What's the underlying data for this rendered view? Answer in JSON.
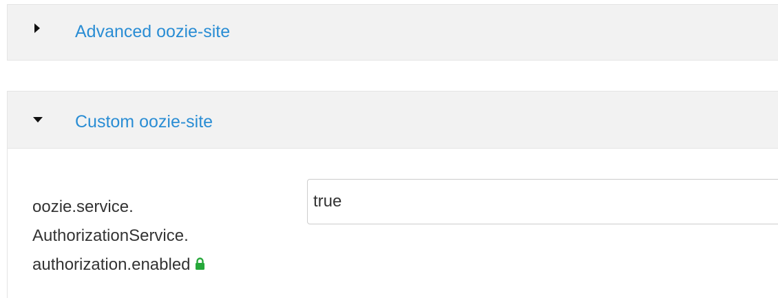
{
  "sections": {
    "advanced": {
      "title": "Advanced oozie-site",
      "expanded": false,
      "icon": "caret-right-icon"
    },
    "custom": {
      "title": "Custom oozie-site",
      "expanded": true,
      "icon": "caret-down-icon",
      "property": {
        "label_lines": [
          "oozie.service.",
          "AuthorizationService.",
          "authorization.enabled"
        ],
        "value": "true",
        "lock_icon": "lock-icon"
      }
    }
  },
  "colors": {
    "link": "#2a8dd4",
    "header_bg": "#f2f2f2",
    "lock": "#26a83a",
    "text": "#333333"
  }
}
